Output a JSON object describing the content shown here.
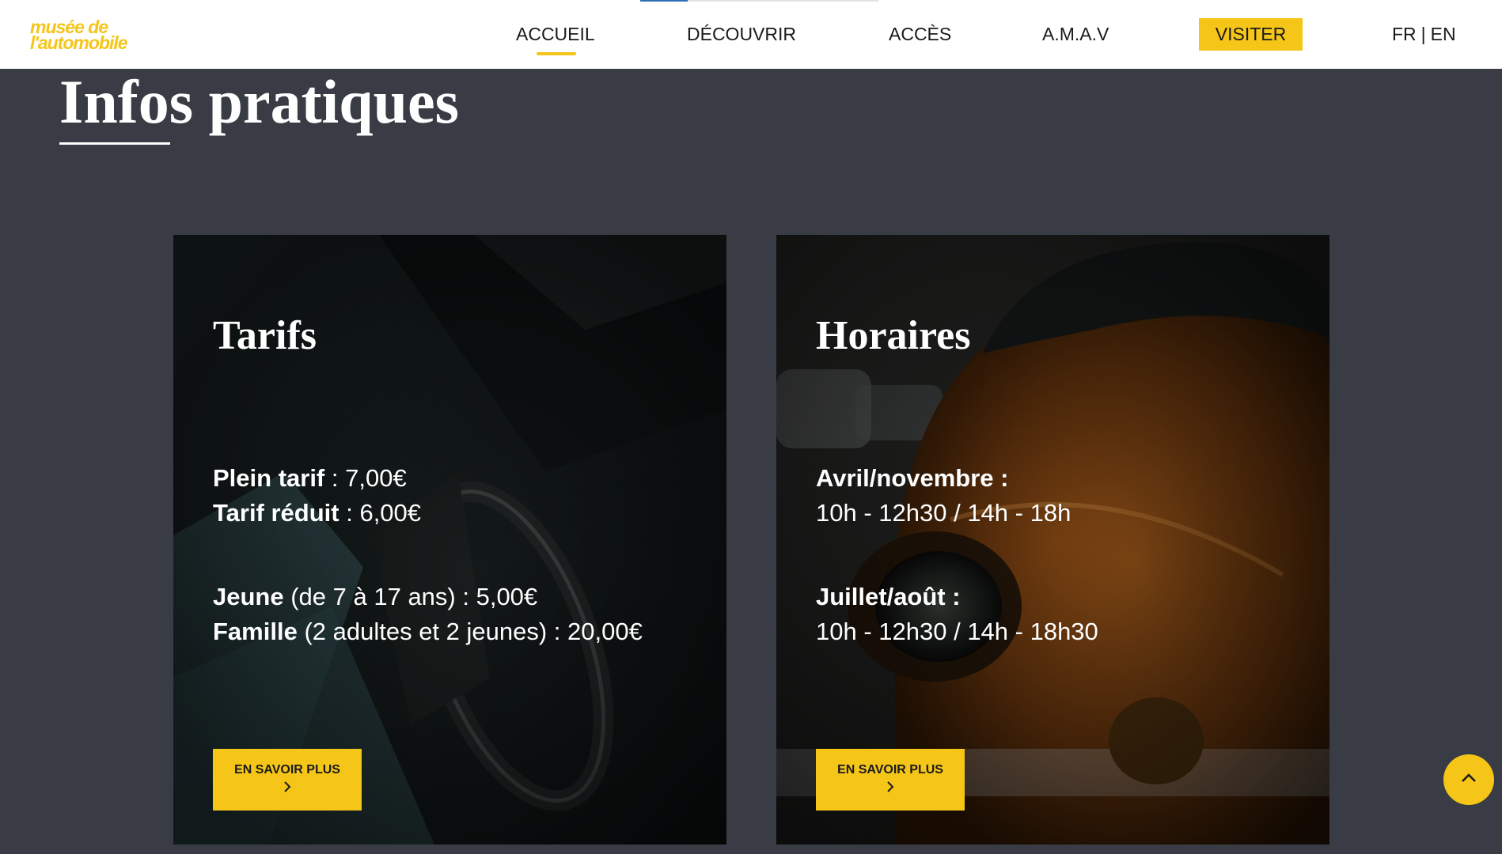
{
  "header": {
    "logo_line1": "musée de",
    "logo_line2": "l'automobile",
    "nav": {
      "accueil": "ACCUEIL",
      "decouvrir": "DÉCOUVRIR",
      "acces": "ACCÈS",
      "amav": "A.M.A.V",
      "visiter": "VISITER"
    },
    "lang": {
      "fr": "FR",
      "separator": "|",
      "en": "EN"
    }
  },
  "main": {
    "title": "Infos pratiques",
    "cards": {
      "tarifs": {
        "title": "Tarifs",
        "lines": [
          {
            "label": "Plein tarif",
            "rest": " : 7,00€"
          },
          {
            "label": "Tarif réduit",
            "rest": " : 6,00€"
          },
          {
            "label": "Jeune",
            "rest": " (de 7 à 17 ans) : 5,00€"
          },
          {
            "label": "Famille",
            "rest": " (2 adultes et 2 jeunes) : 20,00€"
          }
        ],
        "button": "EN SAVOIR PLUS"
      },
      "horaires": {
        "title": "Horaires",
        "lines": [
          {
            "label": "Avril/novembre :",
            "rest": ""
          },
          {
            "label": "",
            "rest": "10h - 12h30 / 14h - 18h"
          },
          {
            "label": "Juillet/août :",
            "rest": ""
          },
          {
            "label": "",
            "rest": "10h - 12h30 / 14h - 18h30"
          }
        ],
        "button": "EN SAVOIR PLUS"
      }
    }
  },
  "icons": {
    "chevron_right": "chevron-right-icon",
    "chevron_up": "chevron-up-icon"
  },
  "colors": {
    "accent": "#f5c518",
    "background": "#393c45",
    "header": "#ffffff"
  }
}
